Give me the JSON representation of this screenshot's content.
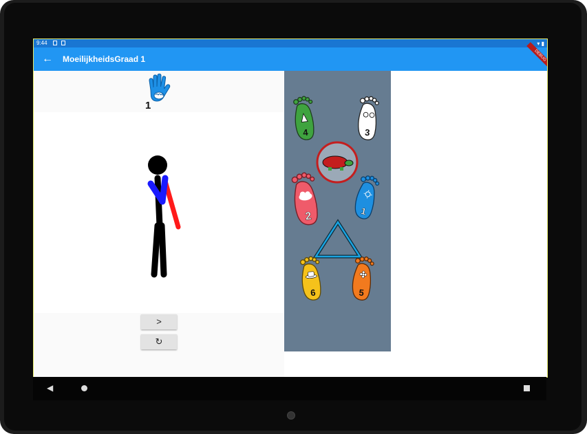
{
  "status": {
    "time": "9:44"
  },
  "appbar": {
    "title": "MoeilijkheidsGraad 1",
    "back": "←"
  },
  "debug_banner": "DEBUG",
  "hand": {
    "level": "1"
  },
  "buttons": {
    "next": ">",
    "reset": "↻"
  },
  "feet": [
    {
      "number": "4",
      "color": "#3fa33f",
      "symbol": "umbrella-icon"
    },
    {
      "number": "3",
      "color": "#ffffff",
      "symbol": "glasses-icon"
    },
    {
      "number": "2",
      "color": "#ef5b6a",
      "symbol": "cloud-icon"
    },
    {
      "number": "1",
      "color": "#1e8fe0",
      "symbol": "sun-icon"
    },
    {
      "number": "6",
      "color": "#f5c21b",
      "symbol": "hat-icon"
    },
    {
      "number": "5",
      "color": "#f27a1e",
      "symbol": "flower-icon"
    }
  ],
  "colors": {
    "appbar": "#2196f3",
    "statusbar": "#1976d2",
    "panel": "#667c91"
  }
}
